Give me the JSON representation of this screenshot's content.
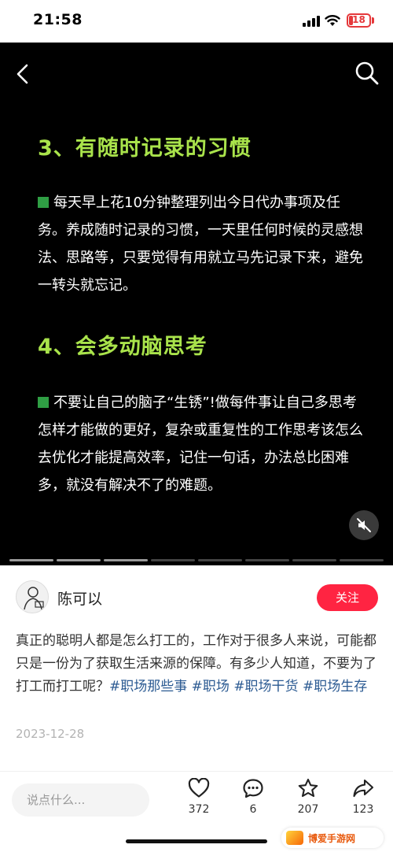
{
  "status_bar": {
    "time": "21:58",
    "battery_level": "18"
  },
  "media": {
    "back_icon": "chevron-left-icon",
    "search_icon": "search-icon",
    "heading_1": "3、有随时记录的习惯",
    "paragraph_1": "每天早上花10分钟整理列出今日代办事项及任务。养成随时记录的习惯，一天里任何时候的灵感想法、思路等，只要觉得有用就立马先记录下来，避免一转头就忘记。",
    "heading_2": "4、会多动脑思考",
    "paragraph_2": "不要让自己的脑子“生锈”!做每件事让自己多思考怎样才能做的更好，复杂或重复性的工作思考该怎么去优化才能提高效率，记住一句话，办法总比困难多，就没有解决不了的难题。",
    "mute_icon": "speaker-muted-icon",
    "heading_color": "#a9e34b",
    "bullet_color": "#2f9e44"
  },
  "author": {
    "name": "陈可以",
    "follow_label": "关注",
    "follow_color": "#ff2442"
  },
  "post": {
    "text": "真正的聪明人都是怎么打工的，工作对于很多人来说，可能都只是一份为了获取生活来源的保障。有多少人知道，不要为了打工而打工呢？",
    "hashtags": [
      "#职场那些事",
      "#职场",
      "#职场干货",
      "#职场生存"
    ],
    "date": "2023-12-28"
  },
  "bottom_bar": {
    "comment_placeholder": "说点什么...",
    "likes": "372",
    "comments": "6",
    "stars": "207",
    "shares": "123"
  },
  "watermark": {
    "text": "博爱手游网"
  }
}
